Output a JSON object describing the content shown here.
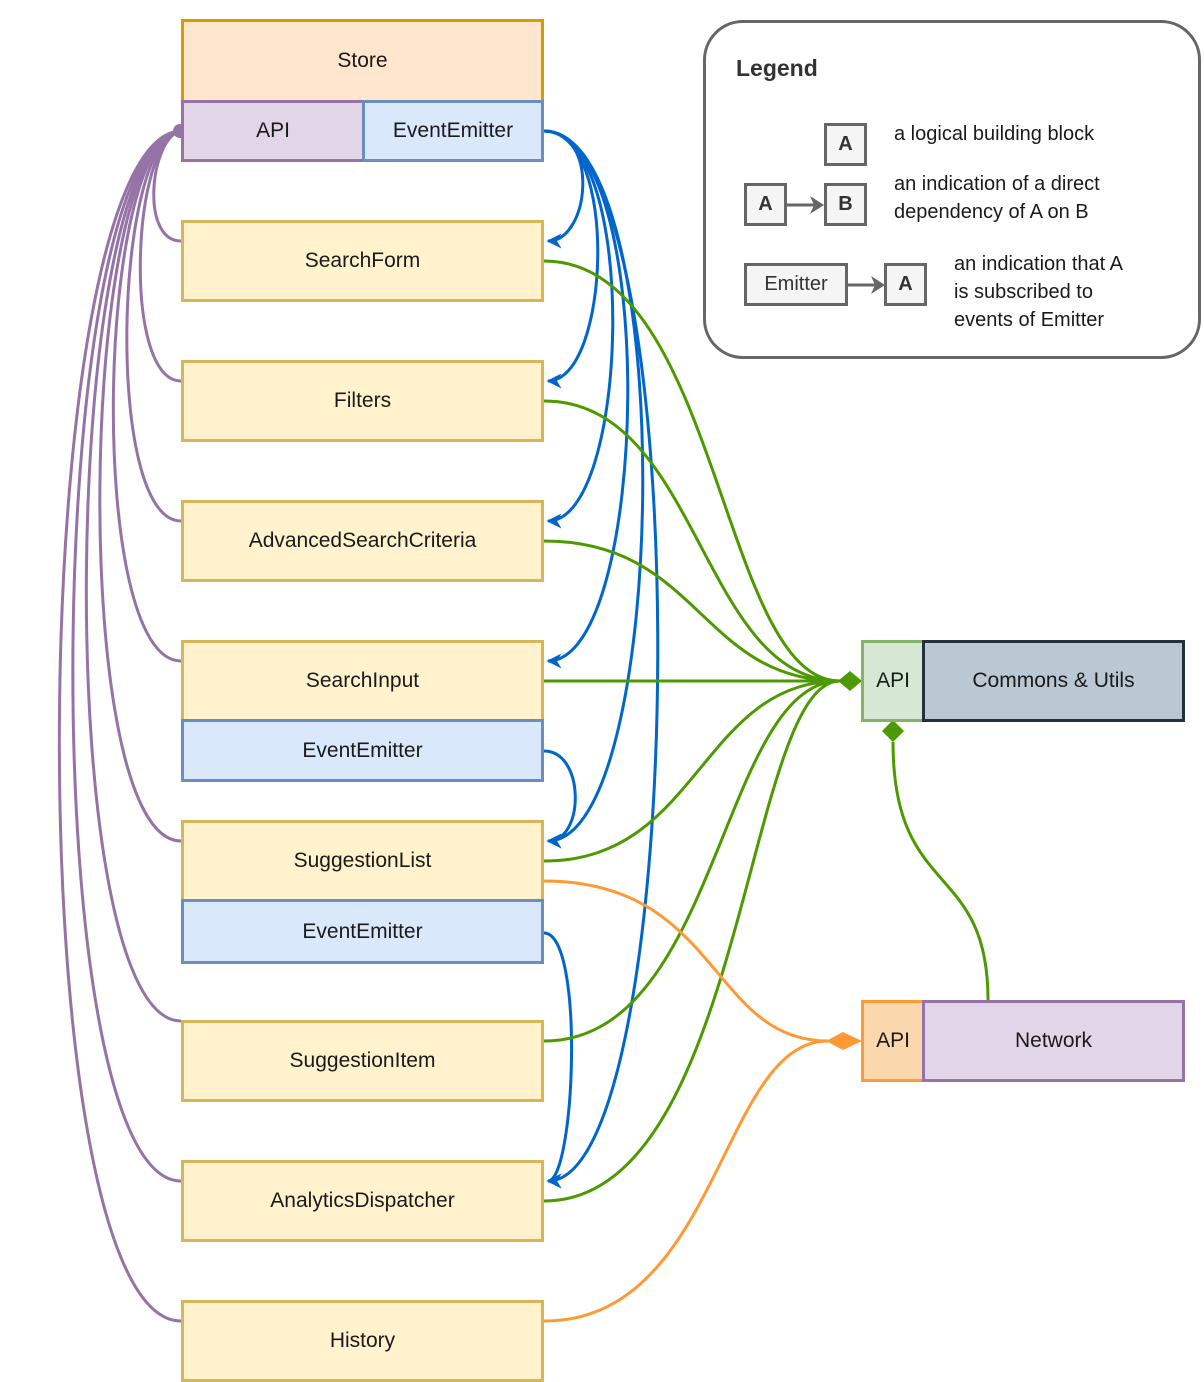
{
  "store": {
    "title": "Store",
    "api": "API",
    "emitter": "EventEmitter"
  },
  "components": [
    {
      "id": "searchform",
      "label": "SearchForm"
    },
    {
      "id": "filters",
      "label": "Filters"
    },
    {
      "id": "advanced",
      "label": "AdvancedSearchCriteria"
    },
    {
      "id": "searchinput",
      "label": "SearchInput",
      "emitter": "EventEmitter"
    },
    {
      "id": "suggestionlist",
      "label": "SuggestionList",
      "emitter": "EventEmitter"
    },
    {
      "id": "suggestionitem",
      "label": "SuggestionItem"
    },
    {
      "id": "analytics",
      "label": "AnalyticsDispatcher"
    },
    {
      "id": "history",
      "label": "History"
    }
  ],
  "commons": {
    "api": "API",
    "label": "Commons & Utils"
  },
  "network": {
    "api": "API",
    "label": "Network"
  },
  "legend": {
    "title": "Legend",
    "block_sample": "A",
    "block_text": "a logical building block",
    "dep_from": "A",
    "dep_to": "B",
    "dep_text_1": "an indication of a direct",
    "dep_text_2": "dependency of A on B",
    "sub_from": "Emitter",
    "sub_to": "A",
    "sub_text_1": "an indication that A",
    "sub_text_2": "is subscribed to",
    "sub_text_3": "events of Emitter"
  },
  "colors": {
    "store_api_edge": "#9673a6",
    "emitter_edge": "#0066cc",
    "commons_edge": "#4d9900",
    "network_edge": "#ff9933",
    "legend_edge": "#666666"
  },
  "edges": {
    "store_api_users": [
      "searchform",
      "filters",
      "advanced",
      "searchinput",
      "suggestionlist",
      "suggestionitem",
      "analytics",
      "history"
    ],
    "store_emitter_subscribers": [
      "searchform",
      "filters",
      "advanced",
      "searchinput",
      "suggestionlist",
      "analytics"
    ],
    "searchinput_emitter_subscribers": [
      "suggestionlist"
    ],
    "suggestionlist_emitter_subscribers": [
      "analytics"
    ],
    "commons_api_users": [
      "searchform",
      "filters",
      "advanced",
      "searchinput",
      "suggestionlist",
      "suggestionitem",
      "analytics",
      "network"
    ],
    "network_api_users": [
      "suggestionlist",
      "history"
    ]
  }
}
